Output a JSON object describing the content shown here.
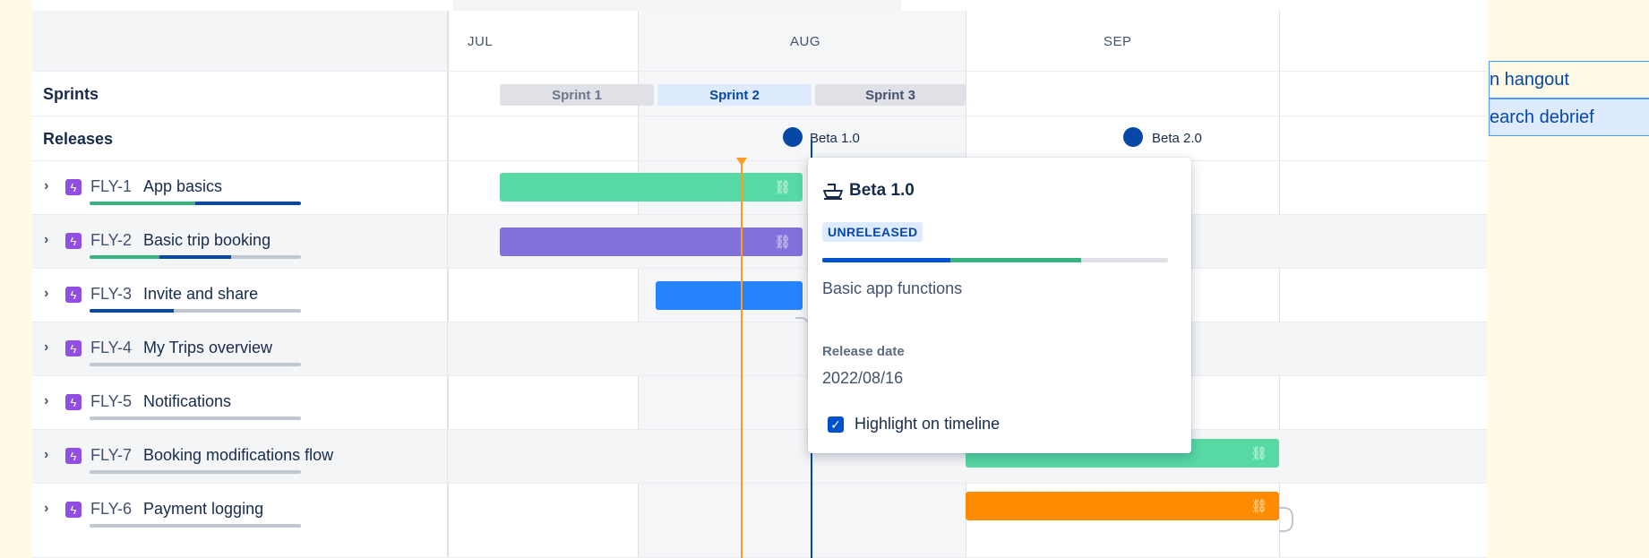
{
  "timeline": {
    "months": [
      "JUL",
      "AUG",
      "SEP"
    ],
    "rows": {
      "sprints_label": "Sprints",
      "releases_label": "Releases"
    },
    "sprints": [
      {
        "label": "Sprint 1",
        "state": "closed"
      },
      {
        "label": "Sprint 2",
        "state": "active"
      },
      {
        "label": "Sprint 3",
        "state": "future"
      }
    ],
    "releases": [
      {
        "label": "Beta 1.0"
      },
      {
        "label": "Beta 2.0"
      }
    ],
    "epics": [
      {
        "key": "FLY-1",
        "summary": "App basics",
        "done": 0.5,
        "in_progress": 0.5,
        "bar_color": "#57d9a3"
      },
      {
        "key": "FLY-2",
        "summary": "Basic trip booking",
        "done": 0.33,
        "in_progress": 0.34,
        "bar_color": "#8270db"
      },
      {
        "key": "FLY-3",
        "summary": "Invite and share",
        "done": 0,
        "in_progress": 0.4,
        "bar_color": "#2684ff"
      },
      {
        "key": "FLY-4",
        "summary": "My Trips overview",
        "done": 0,
        "in_progress": 0,
        "bar_color": null
      },
      {
        "key": "FLY-5",
        "summary": "Notifications",
        "done": 0,
        "in_progress": 0,
        "bar_color": null
      },
      {
        "key": "FLY-7",
        "summary": "Booking modifications flow",
        "done": 0,
        "in_progress": 0,
        "bar_color": "#57d9a3"
      },
      {
        "key": "FLY-6",
        "summary": "Payment logging",
        "done": 0,
        "in_progress": 0,
        "bar_color": "#ff8b00"
      }
    ]
  },
  "popup": {
    "title": "Beta 1.0",
    "status": "UNRELEASED",
    "progress_done": 0.37,
    "progress_in_progress": 0.38,
    "description": "Basic app functions",
    "release_date_label": "Release date",
    "release_date": "2022/08/16",
    "highlight_label": "Highlight on timeline",
    "highlight_checked": true
  },
  "side_panel": {
    "items": [
      "n hangout",
      "earch debrief"
    ]
  },
  "colors": {
    "release_blue": "#0747a6",
    "today_orange": "#ff991f",
    "epic_purple": "#904ee2"
  }
}
